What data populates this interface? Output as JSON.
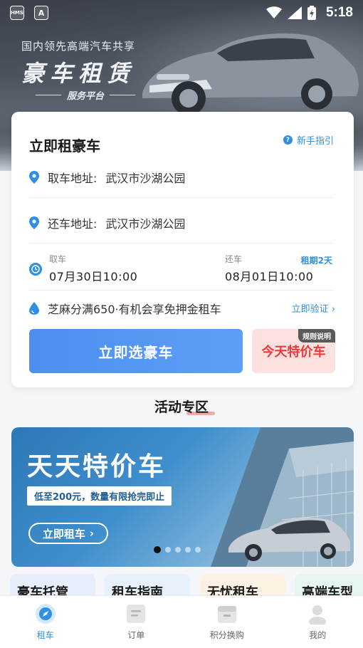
{
  "status_bar": {
    "time": "5:18",
    "chip1": "HMS",
    "chip2": "A"
  },
  "hero": {
    "subtitle": "国内领先高端汽车共享",
    "title": "豪车租赁",
    "tag": "服务平台"
  },
  "rental_card": {
    "title": "立即租豪车",
    "guide_label": "新手指引",
    "pickup": {
      "label": "取车地址:",
      "value": "武汉市沙湖公园"
    },
    "return": {
      "label": "还车地址:",
      "value": "武汉市沙湖公园"
    },
    "pickup_time": {
      "label": "取车",
      "value": "07月30日10:00"
    },
    "return_time": {
      "label": "还车",
      "value": "08月01日10:00"
    },
    "period": "租期2天",
    "sesame": "芝麻分满650·有机会享免押金租车",
    "verify_label": "立即验证 ›",
    "primary_button": "立即选豪车",
    "special_button": "今天特价车",
    "rule_tag": "规则说明"
  },
  "activity": {
    "section_title": "活动专区",
    "banner_title": "天天特价车",
    "banner_sub": "低至200元，数量有限抢完即止",
    "banner_button": "立即租车",
    "banner_button_arrow": "›",
    "carousel_active_index": 0
  },
  "quick_links": [
    "豪车托管",
    "租车指南",
    "无忧租车",
    "高端车型"
  ],
  "tabs": [
    {
      "label": "租车",
      "icon": "compass-icon",
      "active": true
    },
    {
      "label": "订单",
      "icon": "order-icon",
      "active": false
    },
    {
      "label": "积分换购",
      "icon": "store-icon",
      "active": false
    },
    {
      "label": "我的",
      "icon": "user-icon",
      "active": false
    }
  ],
  "colors": {
    "accent": "#2f8fe0",
    "primary_button": "#4b8ff0",
    "special_bg": "#fde1e1",
    "special_text": "#ee3a3a"
  }
}
